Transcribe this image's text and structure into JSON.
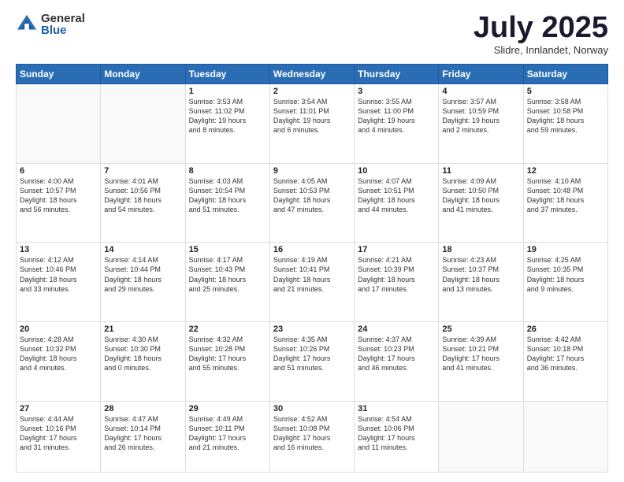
{
  "logo": {
    "general": "General",
    "blue": "Blue"
  },
  "header": {
    "month": "July 2025",
    "location": "Slidre, Innlandet, Norway"
  },
  "weekdays": [
    "Sunday",
    "Monday",
    "Tuesday",
    "Wednesday",
    "Thursday",
    "Friday",
    "Saturday"
  ],
  "weeks": [
    [
      {
        "day": "",
        "info": ""
      },
      {
        "day": "",
        "info": ""
      },
      {
        "day": "1",
        "info": "Sunrise: 3:53 AM\nSunset: 11:02 PM\nDaylight: 19 hours\nand 8 minutes."
      },
      {
        "day": "2",
        "info": "Sunrise: 3:54 AM\nSunset: 11:01 PM\nDaylight: 19 hours\nand 6 minutes."
      },
      {
        "day": "3",
        "info": "Sunrise: 3:55 AM\nSunset: 11:00 PM\nDaylight: 19 hours\nand 4 minutes."
      },
      {
        "day": "4",
        "info": "Sunrise: 3:57 AM\nSunset: 10:59 PM\nDaylight: 19 hours\nand 2 minutes."
      },
      {
        "day": "5",
        "info": "Sunrise: 3:58 AM\nSunset: 10:58 PM\nDaylight: 18 hours\nand 59 minutes."
      }
    ],
    [
      {
        "day": "6",
        "info": "Sunrise: 4:00 AM\nSunset: 10:57 PM\nDaylight: 18 hours\nand 56 minutes."
      },
      {
        "day": "7",
        "info": "Sunrise: 4:01 AM\nSunset: 10:56 PM\nDaylight: 18 hours\nand 54 minutes."
      },
      {
        "day": "8",
        "info": "Sunrise: 4:03 AM\nSunset: 10:54 PM\nDaylight: 18 hours\nand 51 minutes."
      },
      {
        "day": "9",
        "info": "Sunrise: 4:05 AM\nSunset: 10:53 PM\nDaylight: 18 hours\nand 47 minutes."
      },
      {
        "day": "10",
        "info": "Sunrise: 4:07 AM\nSunset: 10:51 PM\nDaylight: 18 hours\nand 44 minutes."
      },
      {
        "day": "11",
        "info": "Sunrise: 4:09 AM\nSunset: 10:50 PM\nDaylight: 18 hours\nand 41 minutes."
      },
      {
        "day": "12",
        "info": "Sunrise: 4:10 AM\nSunset: 10:48 PM\nDaylight: 18 hours\nand 37 minutes."
      }
    ],
    [
      {
        "day": "13",
        "info": "Sunrise: 4:12 AM\nSunset: 10:46 PM\nDaylight: 18 hours\nand 33 minutes."
      },
      {
        "day": "14",
        "info": "Sunrise: 4:14 AM\nSunset: 10:44 PM\nDaylight: 18 hours\nand 29 minutes."
      },
      {
        "day": "15",
        "info": "Sunrise: 4:17 AM\nSunset: 10:43 PM\nDaylight: 18 hours\nand 25 minutes."
      },
      {
        "day": "16",
        "info": "Sunrise: 4:19 AM\nSunset: 10:41 PM\nDaylight: 18 hours\nand 21 minutes."
      },
      {
        "day": "17",
        "info": "Sunrise: 4:21 AM\nSunset: 10:39 PM\nDaylight: 18 hours\nand 17 minutes."
      },
      {
        "day": "18",
        "info": "Sunrise: 4:23 AM\nSunset: 10:37 PM\nDaylight: 18 hours\nand 13 minutes."
      },
      {
        "day": "19",
        "info": "Sunrise: 4:25 AM\nSunset: 10:35 PM\nDaylight: 18 hours\nand 9 minutes."
      }
    ],
    [
      {
        "day": "20",
        "info": "Sunrise: 4:28 AM\nSunset: 10:32 PM\nDaylight: 18 hours\nand 4 minutes."
      },
      {
        "day": "21",
        "info": "Sunrise: 4:30 AM\nSunset: 10:30 PM\nDaylight: 18 hours\nand 0 minutes."
      },
      {
        "day": "22",
        "info": "Sunrise: 4:32 AM\nSunset: 10:28 PM\nDaylight: 17 hours\nand 55 minutes."
      },
      {
        "day": "23",
        "info": "Sunrise: 4:35 AM\nSunset: 10:26 PM\nDaylight: 17 hours\nand 51 minutes."
      },
      {
        "day": "24",
        "info": "Sunrise: 4:37 AM\nSunset: 10:23 PM\nDaylight: 17 hours\nand 46 minutes."
      },
      {
        "day": "25",
        "info": "Sunrise: 4:39 AM\nSunset: 10:21 PM\nDaylight: 17 hours\nand 41 minutes."
      },
      {
        "day": "26",
        "info": "Sunrise: 4:42 AM\nSunset: 10:18 PM\nDaylight: 17 hours\nand 36 minutes."
      }
    ],
    [
      {
        "day": "27",
        "info": "Sunrise: 4:44 AM\nSunset: 10:16 PM\nDaylight: 17 hours\nand 31 minutes."
      },
      {
        "day": "28",
        "info": "Sunrise: 4:47 AM\nSunset: 10:14 PM\nDaylight: 17 hours\nand 26 minutes."
      },
      {
        "day": "29",
        "info": "Sunrise: 4:49 AM\nSunset: 10:11 PM\nDaylight: 17 hours\nand 21 minutes."
      },
      {
        "day": "30",
        "info": "Sunrise: 4:52 AM\nSunset: 10:08 PM\nDaylight: 17 hours\nand 16 minutes."
      },
      {
        "day": "31",
        "info": "Sunrise: 4:54 AM\nSunset: 10:06 PM\nDaylight: 17 hours\nand 11 minutes."
      },
      {
        "day": "",
        "info": ""
      },
      {
        "day": "",
        "info": ""
      }
    ]
  ]
}
